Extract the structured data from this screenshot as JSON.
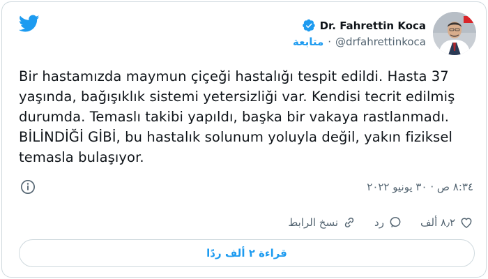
{
  "author": {
    "display_name": "Dr. Fahrettin Koca",
    "handle": "@drfahrettinkoca",
    "follow_label": "متابعة",
    "separator": "·"
  },
  "tweet": {
    "text": "Bir hastamızda maymun çiçeği hastalığı tespit edildi. Hasta 37 yaşında, bağışıklık sistemi yetersizliği var. Kendisi tecrit edilmiş durumda. Temaslı takibi yapıldı, başka bir vakaya rastlanmadı. BİLİNDİĞİ GİBİ, bu hastalık solunum yoluyla değil, yakın fiziksel temasla bulaşıyor.",
    "timestamp": "٨:٣٤ ص · ٣٠ يونيو ٢٠٢٢"
  },
  "actions": {
    "likes_count": "٨٫٢ ألف",
    "reply_label": "رد",
    "copy_link_label": "نسخ الرابط"
  },
  "read_replies_label": "قراءة ٢ ألف ردًا",
  "colors": {
    "accent": "#1d9bf0",
    "text": "#0f1419",
    "muted": "#536471",
    "border": "#cfd9de"
  },
  "icons": [
    "twitter-bird-icon",
    "verified-badge-icon",
    "info-icon",
    "heart-icon",
    "reply-bubble-icon",
    "link-icon"
  ]
}
